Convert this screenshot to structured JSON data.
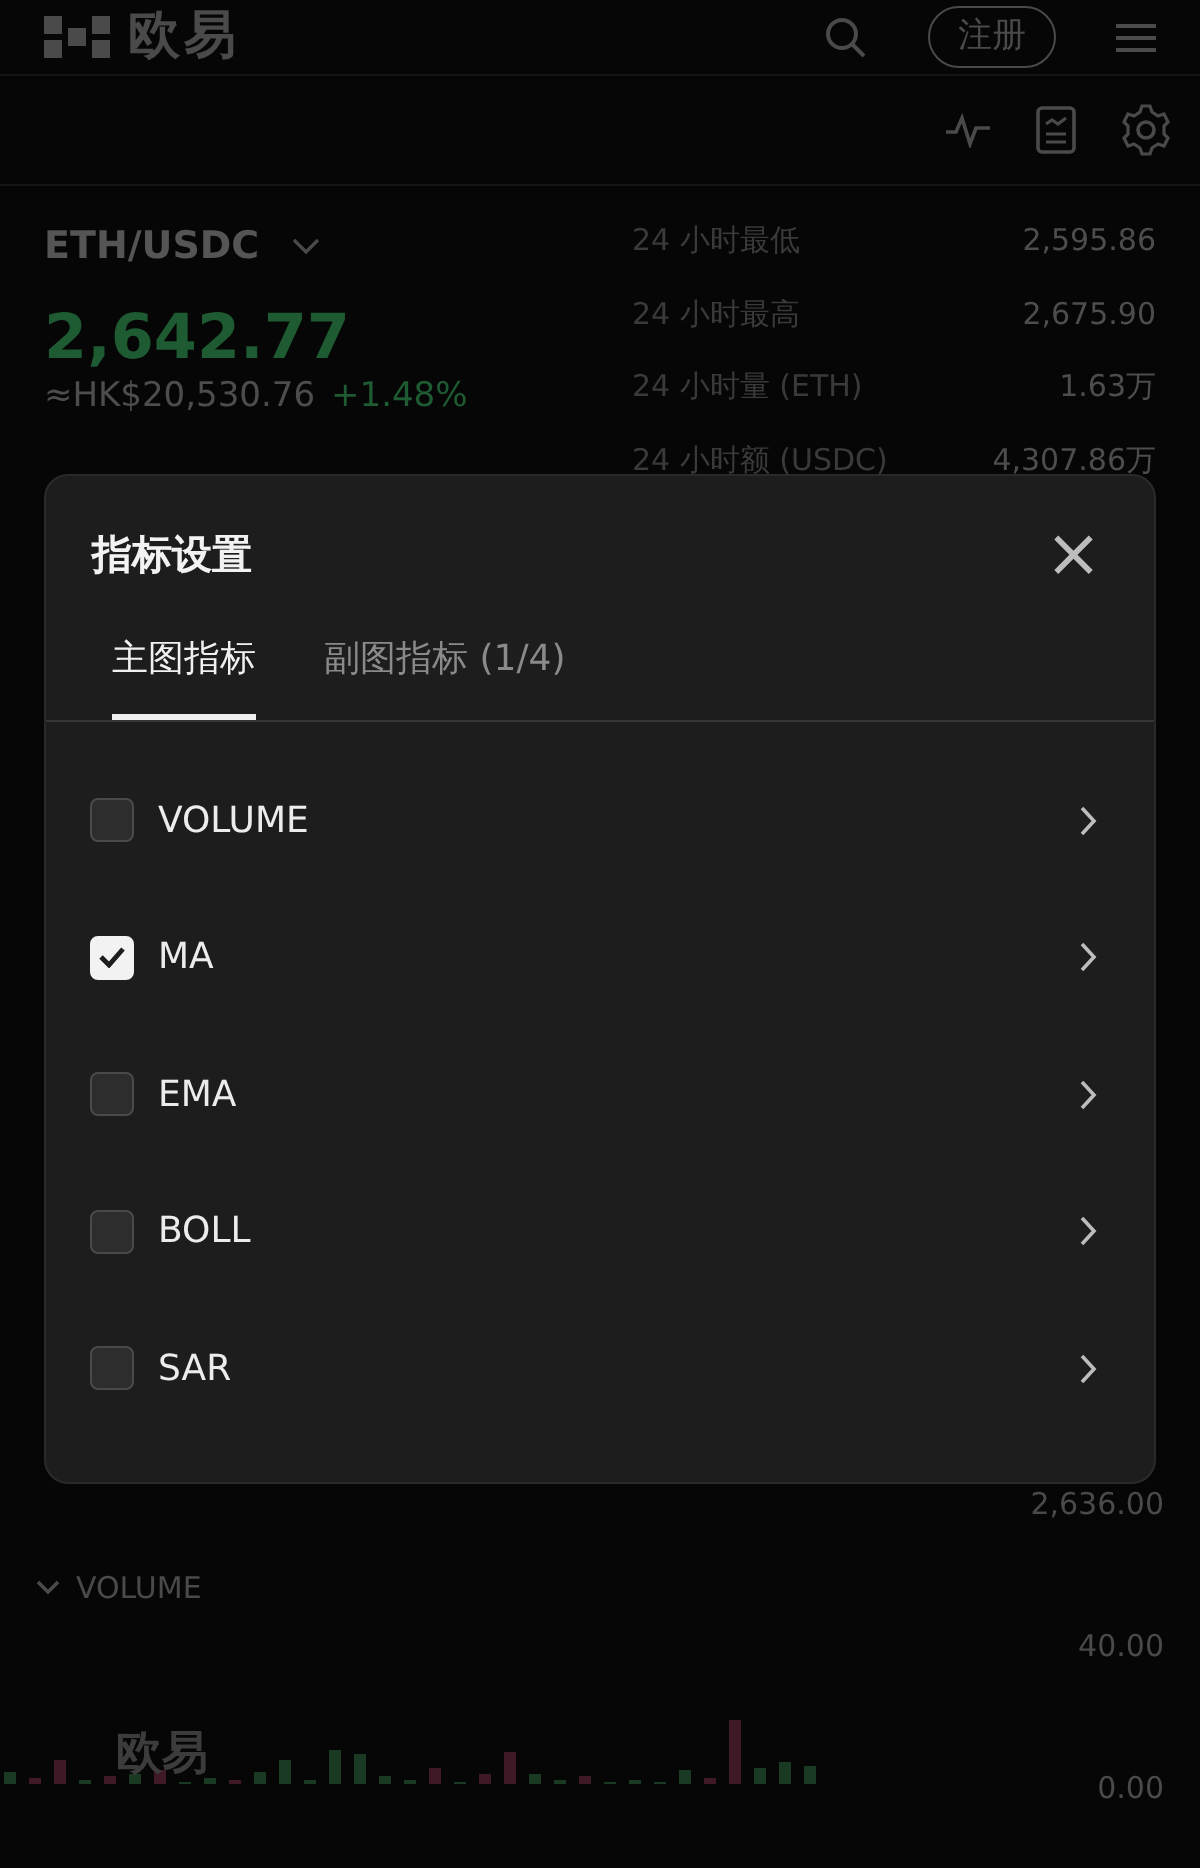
{
  "header": {
    "logo": "欧易",
    "register_button": "注册"
  },
  "market": {
    "pair": "ETH/USDC",
    "price": "2,642.77",
    "converted": "≈HK$20,530.76",
    "change": "+1.48%"
  },
  "stats": [
    {
      "label": "24 小时最低",
      "value": "2,595.86"
    },
    {
      "label": "24 小时最高",
      "value": "2,675.90"
    },
    {
      "label": "24 小时量 (ETH)",
      "value": "1.63万"
    },
    {
      "label": "24 小时额 (USDC)",
      "value": "4,307.86万"
    }
  ],
  "chart": {
    "price_axis_label": "2,636.00",
    "volume_title": "VOLUME",
    "volume_ticks": [
      "40.00",
      "0.00"
    ],
    "watermark_logo": "欧易"
  },
  "dialog": {
    "title": "指标设置",
    "close": "×",
    "tabs": [
      {
        "label": "主图指标",
        "selected": true
      },
      {
        "label": "副图指标 (1/4)",
        "selected": false
      }
    ],
    "indicators": [
      {
        "name": "VOLUME",
        "checked": false
      },
      {
        "name": "MA",
        "checked": true
      },
      {
        "name": "EMA",
        "checked": false
      },
      {
        "name": "BOLL",
        "checked": false
      },
      {
        "name": "SAR",
        "checked": false
      }
    ]
  }
}
